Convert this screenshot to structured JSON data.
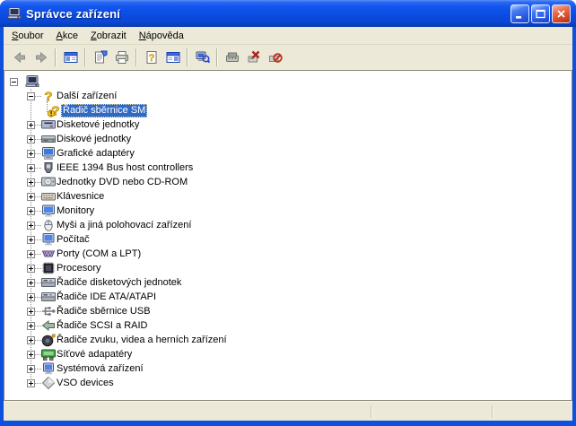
{
  "window": {
    "title": "Správce zařízení"
  },
  "menu_bar": {
    "items": [
      {
        "id": "soubor",
        "label": "Soubor"
      },
      {
        "id": "akce",
        "label": "Akce"
      },
      {
        "id": "zobrazit",
        "label": "Zobrazit"
      },
      {
        "id": "napoveda",
        "label": "Nápověda"
      }
    ]
  },
  "toolbar": {
    "items": [
      {
        "type": "button",
        "name": "back-button",
        "icon": "back-arrow",
        "disabled": true
      },
      {
        "type": "button",
        "name": "forward-button",
        "icon": "forward-arrow",
        "disabled": true
      },
      {
        "type": "separator"
      },
      {
        "type": "button",
        "name": "show-hide-console-tree-button",
        "icon": "console-tree"
      },
      {
        "type": "separator"
      },
      {
        "type": "button",
        "name": "properties-button",
        "icon": "properties"
      },
      {
        "type": "button",
        "name": "print-button",
        "icon": "printer"
      },
      {
        "type": "separator"
      },
      {
        "type": "button",
        "name": "help-button",
        "icon": "help-doc"
      },
      {
        "type": "button",
        "name": "show-hide-action-pane-button",
        "icon": "action-pane"
      },
      {
        "type": "separator"
      },
      {
        "type": "button",
        "name": "scan-hardware-changes-button",
        "icon": "scan-computer"
      },
      {
        "type": "separator"
      },
      {
        "type": "button",
        "name": "update-driver-button",
        "icon": "update-driver"
      },
      {
        "type": "button",
        "name": "uninstall-button",
        "icon": "uninstall"
      },
      {
        "type": "button",
        "name": "disable-button",
        "icon": "disable"
      }
    ]
  },
  "tree": {
    "items": [
      {
        "key": "root-computer",
        "label": "",
        "level": 0,
        "expander": "minus",
        "icon": "computer-root"
      },
      {
        "key": "other-devices",
        "label": "Další zařízení",
        "level": 1,
        "expander": "minus",
        "icon": "unknown-device"
      },
      {
        "key": "sm-bus-controller",
        "label": "Řadič sběrnice SM",
        "level": 2,
        "expander": null,
        "icon": "unknown-device-alert",
        "selected": true
      },
      {
        "key": "floppy-disk-drives",
        "label": "Disketové jednotky",
        "level": 1,
        "expander": "plus",
        "icon": "floppy-drive"
      },
      {
        "key": "disk-drives",
        "label": "Diskové jednotky",
        "level": 1,
        "expander": "plus",
        "icon": "disk-drive"
      },
      {
        "key": "display-adapters",
        "label": "Grafické adaptéry",
        "level": 1,
        "expander": "plus",
        "icon": "display-adapter"
      },
      {
        "key": "ieee-1394-controllers",
        "label": "IEEE 1394 Bus host controllers",
        "level": 1,
        "expander": "plus",
        "icon": "ieee-1394"
      },
      {
        "key": "dvd-cdrom-drives",
        "label": "Jednotky DVD nebo CD-ROM",
        "level": 1,
        "expander": "plus",
        "icon": "dvd-drive"
      },
      {
        "key": "keyboards",
        "label": "Klávesnice",
        "level": 1,
        "expander": "plus",
        "icon": "keyboard"
      },
      {
        "key": "monitors",
        "label": "Monitory",
        "level": 1,
        "expander": "plus",
        "icon": "monitor"
      },
      {
        "key": "mice-pointing-devices",
        "label": "Myši a jiná polohovací zařízení",
        "level": 1,
        "expander": "plus",
        "icon": "mouse"
      },
      {
        "key": "computer",
        "label": "Počítač",
        "level": 1,
        "expander": "plus",
        "icon": "computer"
      },
      {
        "key": "ports-com-lpt",
        "label": "Porty (COM a LPT)",
        "level": 1,
        "expander": "plus",
        "icon": "serial-port"
      },
      {
        "key": "processors",
        "label": "Procesory",
        "level": 1,
        "expander": "plus",
        "icon": "processor"
      },
      {
        "key": "floppy-controllers",
        "label": "Řadiče disketových jednotek",
        "level": 1,
        "expander": "plus",
        "icon": "controller-card"
      },
      {
        "key": "ide-ata-atapi-controllers",
        "label": "Řadiče IDE ATA/ATAPI",
        "level": 1,
        "expander": "plus",
        "icon": "controller-card"
      },
      {
        "key": "usb-controllers",
        "label": "Řadiče sběrnice USB",
        "level": 1,
        "expander": "plus",
        "icon": "usb-connector"
      },
      {
        "key": "scsi-raid-controllers",
        "label": "Řadiče SCSI a RAID",
        "level": 1,
        "expander": "plus",
        "icon": "scsi-connector"
      },
      {
        "key": "sound-video-game-controllers",
        "label": "Řadiče zvuku, videa a herních zařízení",
        "level": 1,
        "expander": "plus",
        "icon": "speaker"
      },
      {
        "key": "network-adapters",
        "label": "Síťové adapatéry",
        "level": 1,
        "expander": "plus",
        "icon": "network-adapter"
      },
      {
        "key": "system-devices",
        "label": "Systémová zařízení",
        "level": 1,
        "expander": "plus",
        "icon": "system-device"
      },
      {
        "key": "vso-devices",
        "label": "VSO devices",
        "level": 1,
        "expander": "plus",
        "icon": "vso-device"
      }
    ]
  },
  "status_bar": {
    "text": ""
  },
  "colors": {
    "titlebar_blue": "#0d50dd",
    "selection_blue": "#316AC5",
    "chrome_beige": "#ECE9D8",
    "close_red": "#D94E2A",
    "warning_yellow": "#F8C800"
  }
}
